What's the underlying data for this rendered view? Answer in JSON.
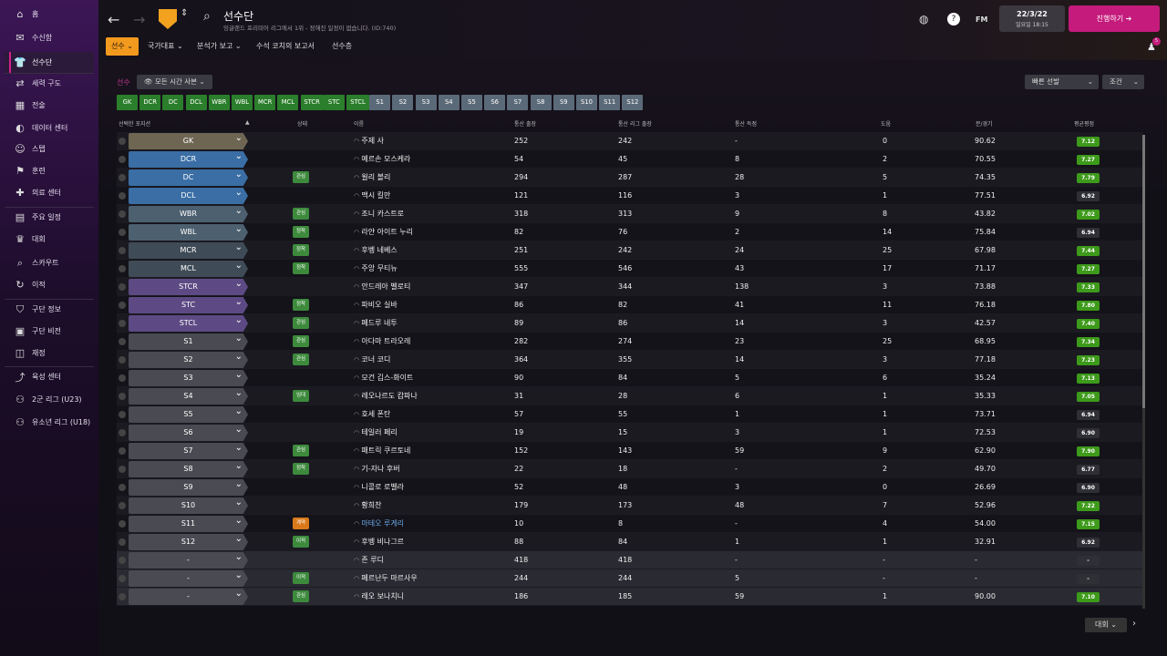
{
  "sidebar": {
    "items": [
      {
        "label": "홈",
        "icon": "home-icon",
        "glyph": "⌂"
      },
      {
        "label": "수신함",
        "icon": "inbox-icon",
        "glyph": "✉"
      },
      {
        "label": "선수단",
        "icon": "squad-icon",
        "glyph": "👕"
      },
      {
        "label": "세력 구도",
        "icon": "dynamics-icon",
        "glyph": "⇄"
      },
      {
        "label": "전술",
        "icon": "tactics-icon",
        "glyph": "▦"
      },
      {
        "label": "데이터 센터",
        "icon": "data-icon",
        "glyph": "◐"
      },
      {
        "label": "스탭",
        "icon": "staff-icon",
        "glyph": "☺"
      },
      {
        "label": "훈련",
        "icon": "training-icon",
        "glyph": "⚑"
      },
      {
        "label": "의료 센터",
        "icon": "medical-icon",
        "glyph": "✚"
      },
      {
        "label": "주요 일정",
        "icon": "calendar-icon",
        "glyph": "▤"
      },
      {
        "label": "대회",
        "icon": "trophy-icon",
        "glyph": "♛"
      },
      {
        "label": "스카우트",
        "icon": "scout-icon",
        "glyph": "⌕"
      },
      {
        "label": "이적",
        "icon": "transfer-icon",
        "glyph": "↻"
      },
      {
        "label": "구단 정보",
        "icon": "club-info-icon",
        "glyph": "⛉"
      },
      {
        "label": "구단 비전",
        "icon": "vision-icon",
        "glyph": "▣"
      },
      {
        "label": "재정",
        "icon": "finance-icon",
        "glyph": "◫"
      },
      {
        "label": "육성 센터",
        "icon": "development-icon",
        "glyph": "⤴"
      },
      {
        "label": "2군 리그 (U23)",
        "icon": "reserves-icon",
        "glyph": "⚇"
      },
      {
        "label": "유소년 리그 (U18)",
        "icon": "youth-icon",
        "glyph": "⚇"
      }
    ]
  },
  "header": {
    "title": "선수단",
    "subtitle": "잉글랜드 프리미어 리그에서 1위 - 정해진 일정이 없습니다. (ID:740)",
    "date": "22/3/22",
    "time": "일요일 18:15",
    "proceed": "진행하기",
    "fm": "FM",
    "notif_count": "5",
    "tabs": [
      "선수",
      "국가대표",
      "분석가 보고",
      "수석 코치의 보고서",
      "선수층"
    ]
  },
  "filters": {
    "view": "모든 시간 사본",
    "quick_pick": "빠른 선발",
    "condition": "조건"
  },
  "section_label": "선수",
  "position_buttons": [
    "GK",
    "DCR",
    "DC",
    "DCL",
    "WBR",
    "WBL",
    "MCR",
    "MCL",
    "STCR",
    "STC",
    "STCL",
    "S1",
    "S2",
    "S3",
    "S4",
    "S5",
    "S6",
    "S7",
    "S8",
    "S9",
    "S10",
    "S11",
    "S12"
  ],
  "columns": [
    "선택한 포지션",
    "상태",
    "이름",
    "통산 출장",
    "통산 리그 출장",
    "통산 득점",
    "도움",
    "분/경기",
    "평균평점"
  ],
  "players": [
    {
      "pos": "GK",
      "status": "",
      "name": "주제 사",
      "apps": "252",
      "league": "242",
      "goals": "-",
      "assists": "0",
      "mpg": "90.62",
      "rating": "7.12"
    },
    {
      "pos": "DCR",
      "status": "",
      "name": "예르손 모스케라",
      "apps": "54",
      "league": "45",
      "goals": "8",
      "assists": "2",
      "mpg": "70.55",
      "rating": "7.27"
    },
    {
      "pos": "DC",
      "status": "관심",
      "name": "윌리 볼리",
      "apps": "294",
      "league": "287",
      "goals": "28",
      "assists": "5",
      "mpg": "74.35",
      "rating": "7.79"
    },
    {
      "pos": "DCL",
      "status": "",
      "name": "맥시 킬만",
      "apps": "121",
      "league": "116",
      "goals": "3",
      "assists": "1",
      "mpg": "77.51",
      "rating": "6.92"
    },
    {
      "pos": "WBR",
      "status": "관심",
      "name": "조니 카스트로",
      "apps": "318",
      "league": "313",
      "goals": "9",
      "assists": "8",
      "mpg": "43.82",
      "rating": "7.02"
    },
    {
      "pos": "WBL",
      "status": "정착",
      "name": "라얀 아이트 누리",
      "apps": "82",
      "league": "76",
      "goals": "2",
      "assists": "14",
      "mpg": "75.84",
      "rating": "6.94"
    },
    {
      "pos": "MCR",
      "status": "정착",
      "name": "후벵 네베스",
      "apps": "251",
      "league": "242",
      "goals": "24",
      "assists": "25",
      "mpg": "67.98",
      "rating": "7.44"
    },
    {
      "pos": "MCL",
      "status": "정착",
      "name": "주앙 무티뉴",
      "apps": "555",
      "league": "546",
      "goals": "43",
      "assists": "17",
      "mpg": "71.17",
      "rating": "7.27"
    },
    {
      "pos": "STCR",
      "status": "",
      "name": "안드레아 벨로티",
      "apps": "347",
      "league": "344",
      "goals": "138",
      "assists": "3",
      "mpg": "73.88",
      "rating": "7.33"
    },
    {
      "pos": "STC",
      "status": "정착",
      "name": "파비오 실바",
      "apps": "86",
      "league": "82",
      "goals": "41",
      "assists": "11",
      "mpg": "76.18",
      "rating": "7.80"
    },
    {
      "pos": "STCL",
      "status": "관심",
      "name": "페드루 네투",
      "apps": "89",
      "league": "86",
      "goals": "14",
      "assists": "3",
      "mpg": "42.57",
      "rating": "7.40"
    },
    {
      "pos": "S1",
      "status": "관심",
      "name": "아다마 트라오레",
      "apps": "282",
      "league": "274",
      "goals": "23",
      "assists": "25",
      "mpg": "68.95",
      "rating": "7.34"
    },
    {
      "pos": "S2",
      "status": "관심",
      "name": "코너 코디",
      "apps": "364",
      "league": "355",
      "goals": "14",
      "assists": "3",
      "mpg": "77.18",
      "rating": "7.23"
    },
    {
      "pos": "S3",
      "status": "",
      "name": "모건 깁스-화이트",
      "apps": "90",
      "league": "84",
      "goals": "5",
      "assists": "6",
      "mpg": "35.24",
      "rating": "7.13"
    },
    {
      "pos": "S4",
      "status": "임대",
      "name": "레오나르도 캄파나",
      "apps": "31",
      "league": "28",
      "goals": "6",
      "assists": "1",
      "mpg": "35.33",
      "rating": "7.05"
    },
    {
      "pos": "S5",
      "status": "",
      "name": "호세 폰탄",
      "apps": "57",
      "league": "55",
      "goals": "1",
      "assists": "1",
      "mpg": "73.71",
      "rating": "6.94"
    },
    {
      "pos": "S6",
      "status": "",
      "name": "테일러 페리",
      "apps": "19",
      "league": "15",
      "goals": "3",
      "assists": "1",
      "mpg": "72.53",
      "rating": "6.90"
    },
    {
      "pos": "S7",
      "status": "관심",
      "name": "패트릭 쿠르토네",
      "apps": "152",
      "league": "143",
      "goals": "59",
      "assists": "9",
      "mpg": "62.90",
      "rating": "7.90"
    },
    {
      "pos": "S8",
      "status": "정착",
      "name": "기-자나 후버",
      "apps": "22",
      "league": "18",
      "goals": "-",
      "assists": "2",
      "mpg": "49.70",
      "rating": "6.77"
    },
    {
      "pos": "S9",
      "status": "",
      "name": "니콜로 로벨라",
      "apps": "52",
      "league": "48",
      "goals": "3",
      "assists": "0",
      "mpg": "26.69",
      "rating": "6.90"
    },
    {
      "pos": "S10",
      "status": "",
      "name": "황희찬",
      "apps": "179",
      "league": "173",
      "goals": "48",
      "assists": "7",
      "mpg": "52.96",
      "rating": "7.22"
    },
    {
      "pos": "S11",
      "status": "계약",
      "name": "마테오 루게리",
      "apps": "10",
      "league": "8",
      "goals": "-",
      "assists": "4",
      "mpg": "54.00",
      "rating": "7.15"
    },
    {
      "pos": "S12",
      "status": "이적",
      "name": "후벵 비나그르",
      "apps": "88",
      "league": "84",
      "goals": "1",
      "assists": "1",
      "mpg": "32.91",
      "rating": "6.92"
    },
    {
      "pos": "-",
      "status": "",
      "name": "존 루디",
      "apps": "418",
      "league": "418",
      "goals": "-",
      "assists": "-",
      "mpg": "-",
      "rating": "-"
    },
    {
      "pos": "-",
      "status": "이적",
      "name": "페르난두 마르사우",
      "apps": "244",
      "league": "244",
      "goals": "5",
      "assists": "-",
      "mpg": "-",
      "rating": "-"
    },
    {
      "pos": "-",
      "status": "관심",
      "name": "레오 보나치니",
      "apps": "186",
      "league": "185",
      "goals": "59",
      "assists": "1",
      "mpg": "90.00",
      "rating": "7.10"
    }
  ],
  "competition": "대회",
  "colors": {
    "accent": "#c41b7c",
    "tab_active": "#f29a1e",
    "rating_green": "#3d9a1a",
    "rating_grey": "#2f2f36"
  }
}
